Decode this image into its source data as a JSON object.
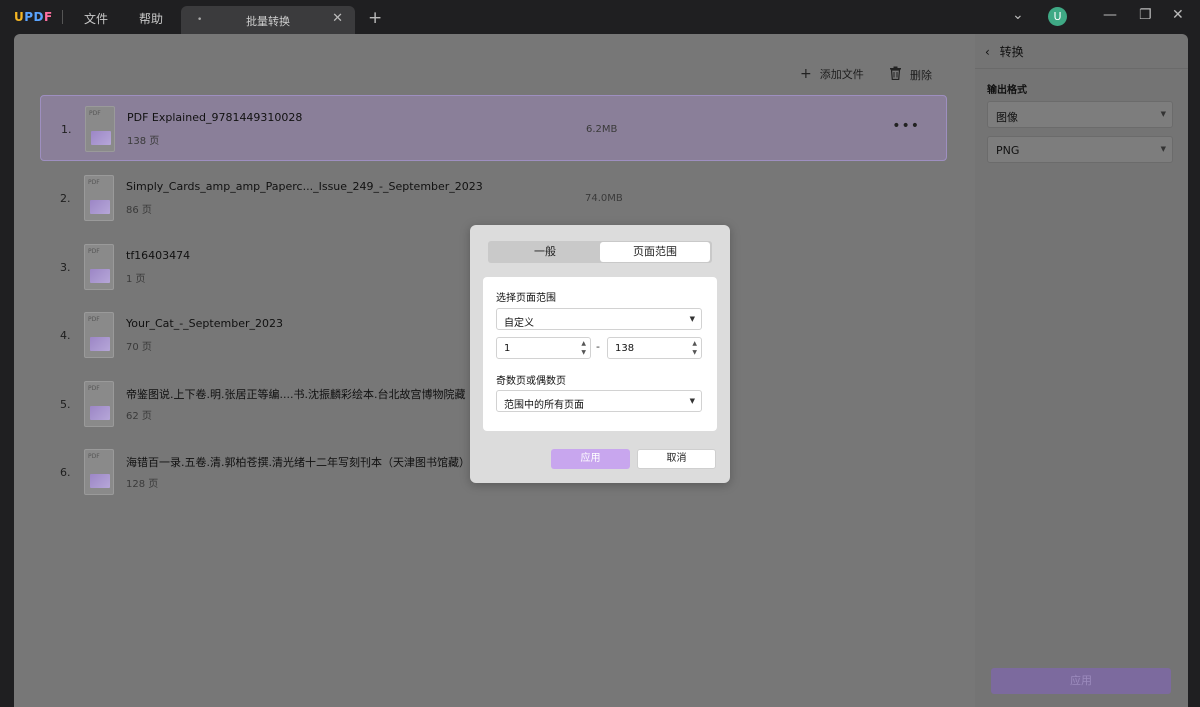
{
  "app": {
    "logo": {
      "u": "U",
      "pd": "PD",
      "f": "F"
    },
    "menu": {
      "file": "文件",
      "help": "帮助"
    },
    "tab": {
      "dot": "•",
      "title": "批量转换",
      "close": "✕",
      "add": "+"
    },
    "avatar_letter": "U",
    "window": {
      "dropdown": "⌄",
      "minimize": "—",
      "restore": "❐",
      "close": "✕"
    }
  },
  "toolbar": {
    "add_file": "添加文件",
    "delete": "删除",
    "add_icon": "+",
    "trash_icon": "🗑"
  },
  "files": [
    {
      "index": "1.",
      "name": "PDF Explained_9781449310028",
      "pages": "138 页",
      "size": "6.2MB",
      "selected": true
    },
    {
      "index": "2.",
      "name": "Simply_Cards_amp_amp_Paperc..._Issue_249_-_September_2023",
      "pages": "86 页",
      "size": "74.0MB"
    },
    {
      "index": "3.",
      "name": "tf16403474",
      "pages": "1 页",
      "size": ""
    },
    {
      "index": "4.",
      "name": "Your_Cat_-_September_2023",
      "pages": "70 页",
      "size": ""
    },
    {
      "index": "5.",
      "name": "帝鉴图说.上下卷.明.张居正等编....书.沈振麟彩绘本.台北故宫博物院藏",
      "pages": "62 页",
      "size": ""
    },
    {
      "index": "6.",
      "name": "海错百一录.五卷.清.郭柏苍撰.清光绪十二年写刻刊本（天津图书馆藏）",
      "pages": "128 页",
      "size": ""
    }
  ],
  "file_more": "•••",
  "thumb_label": "PDF",
  "right_panel": {
    "back_label": "转换",
    "back_icon": "‹",
    "output_format_label": "输出格式",
    "format_value": "图像",
    "subformat_value": "PNG",
    "apply_label": "应用"
  },
  "modal": {
    "tab_general": "一般",
    "tab_page_range": "页面范围",
    "select_range_label": "选择页面范围",
    "range_value": "自定义",
    "from_page": "1",
    "to_page": "138",
    "dash": "-",
    "odd_even_label": "奇数页或偶数页",
    "odd_even_value": "范围中的所有页面",
    "apply": "应用",
    "cancel": "取消"
  },
  "colors": {
    "accent": "#c8a6ee",
    "selected_row": "#8a7f99",
    "avatar": "#3fa985"
  }
}
